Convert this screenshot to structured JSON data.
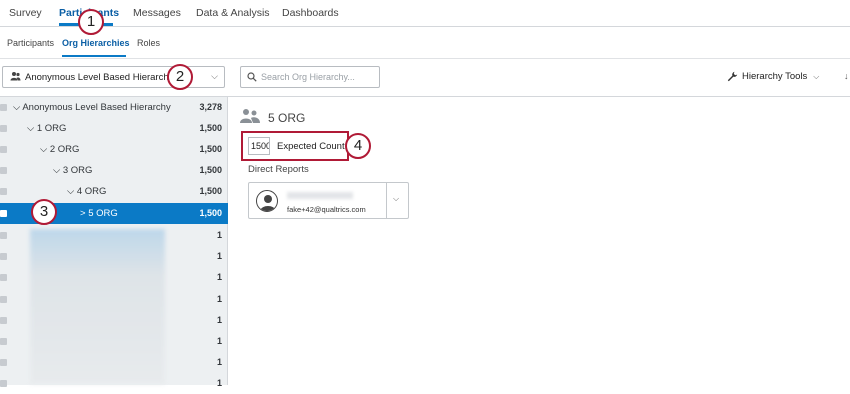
{
  "topnav": {
    "tabs": [
      {
        "label": "Survey"
      },
      {
        "label": "Participants",
        "active": true
      },
      {
        "label": "Messages"
      },
      {
        "label": "Data & Analysis"
      },
      {
        "label": "Dashboards"
      }
    ]
  },
  "subnav": {
    "tabs": [
      {
        "label": "Participants"
      },
      {
        "label": "Org Hierarchies",
        "active": true
      },
      {
        "label": "Roles"
      }
    ]
  },
  "toolbar": {
    "hierarchy_select": "Anonymous Level Based Hierarchy",
    "search_placeholder": "Search Org Hierarchy...",
    "hierarchy_tools": "Hierarchy Tools"
  },
  "tree": {
    "rows": [
      {
        "label": "Anonymous Level Based Hierarchy",
        "count": "3,278",
        "chevron": "⌵"
      },
      {
        "label": "1 ORG",
        "count": "1,500",
        "chevron": "⌵"
      },
      {
        "label": "2 ORG",
        "count": "1,500",
        "chevron": "⌵"
      },
      {
        "label": "3 ORG",
        "count": "1,500",
        "chevron": "⌵"
      },
      {
        "label": "4 ORG",
        "count": "1,500",
        "chevron": "⌵"
      },
      {
        "label": "5 ORG",
        "count": "1,500",
        "chevron": ">",
        "selected": true
      },
      {
        "label": "",
        "count": "1"
      },
      {
        "label": "",
        "count": "1"
      },
      {
        "label": "",
        "count": "1"
      },
      {
        "label": "",
        "count": "1"
      },
      {
        "label": "",
        "count": "1"
      },
      {
        "label": "",
        "count": "1"
      },
      {
        "label": "",
        "count": "1"
      },
      {
        "label": "",
        "count": "1"
      }
    ]
  },
  "detail": {
    "title": "5 ORG",
    "expected_count_value": "1500",
    "expected_count_label": "Expected Count",
    "direct_reports_label": "Direct Reports",
    "direct_report_email": "fake+42@qualtrics.com"
  },
  "badges": [
    "1",
    "2",
    "3",
    "4"
  ],
  "colors": {
    "accent": "#0b7ac6",
    "highlight": "#b01a36",
    "panel": "#edf0f2"
  }
}
